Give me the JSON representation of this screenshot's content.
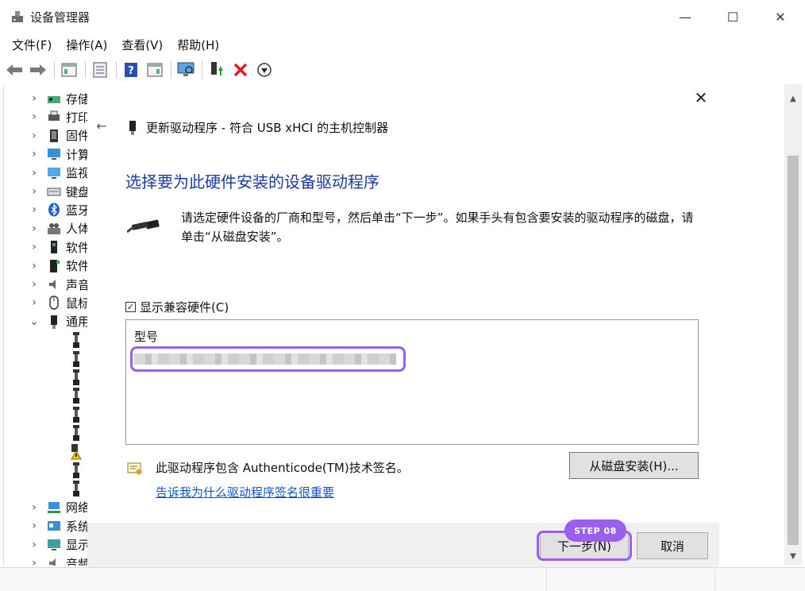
{
  "window": {
    "title": "设备管理器",
    "minimize_glyph": "—",
    "maximize_glyph": "☐",
    "close_glyph": "✕"
  },
  "menu": [
    "文件(F)",
    "操作(A)",
    "查看(V)",
    "帮助(H)"
  ],
  "toolbar_icons": [
    "back-icon",
    "forward-icon",
    "properties-icon",
    "show-hide-icon",
    "help-icon",
    "view-icon",
    "scan-icon",
    "update-driver-icon",
    "uninstall-icon",
    "disable-icon"
  ],
  "tree": {
    "items": [
      {
        "label": "存储",
        "icon": "storage-icon",
        "expanded": false
      },
      {
        "label": "打印",
        "icon": "printer-icon",
        "expanded": false
      },
      {
        "label": "固件",
        "icon": "firmware-icon",
        "expanded": false
      },
      {
        "label": "计算",
        "icon": "computer-icon",
        "expanded": false
      },
      {
        "label": "监视",
        "icon": "monitor-icon",
        "expanded": false
      },
      {
        "label": "键盘",
        "icon": "keyboard-icon",
        "expanded": false
      },
      {
        "label": "蓝牙",
        "icon": "bluetooth-icon",
        "expanded": false
      },
      {
        "label": "人体",
        "icon": "hid-icon",
        "expanded": false
      },
      {
        "label": "软件",
        "icon": "software-component-icon",
        "expanded": false
      },
      {
        "label": "软件",
        "icon": "software-device-icon",
        "expanded": false
      },
      {
        "label": "声音",
        "icon": "sound-icon",
        "expanded": false
      },
      {
        "label": "鼠标",
        "icon": "mouse-icon",
        "expanded": false
      },
      {
        "label": "通用",
        "icon": "usb-icon",
        "expanded": true
      },
      {
        "label": "网络",
        "icon": "network-icon",
        "expanded": false
      },
      {
        "label": "系统",
        "icon": "system-icon",
        "expanded": false
      },
      {
        "label": "显示",
        "icon": "display-icon",
        "expanded": false
      },
      {
        "label": "音频",
        "icon": "audio-icon",
        "expanded": false
      }
    ],
    "usb_children": [
      "usb-device-icon",
      "usb-device-icon",
      "usb-device-icon",
      "usb-device-icon",
      "usb-device-icon",
      "usb-device-icon",
      "usb-warning-icon",
      "usb-device-icon",
      "usb-device-icon"
    ]
  },
  "dialog": {
    "header": "更新驱动程序 - 符合 USB xHCI 的主机控制器",
    "heading": "选择要为此硬件安装的设备驱动程序",
    "instructions": "请选定硬件设备的厂商和型号，然后单击“下一步”。如果手头有包含要安装的驱动程序的磁盘，请单击“从磁盘安装”。",
    "compat_label": "显示兼容硬件(C)",
    "compat_checked": true,
    "list_header": "型号",
    "signature_text": "此驱动程序包含 Authenticode(TM)技术签名。",
    "signature_link": "告诉我为什么驱动程序签名很重要",
    "disk_button": "从磁盘安装(H)...",
    "next_button": "下一步(N)",
    "cancel_button": "取消",
    "step_badge": "STEP 08"
  },
  "colors": {
    "accent": "#9b5ef0",
    "heading": "#1a3aa8",
    "link": "#1055cc"
  }
}
